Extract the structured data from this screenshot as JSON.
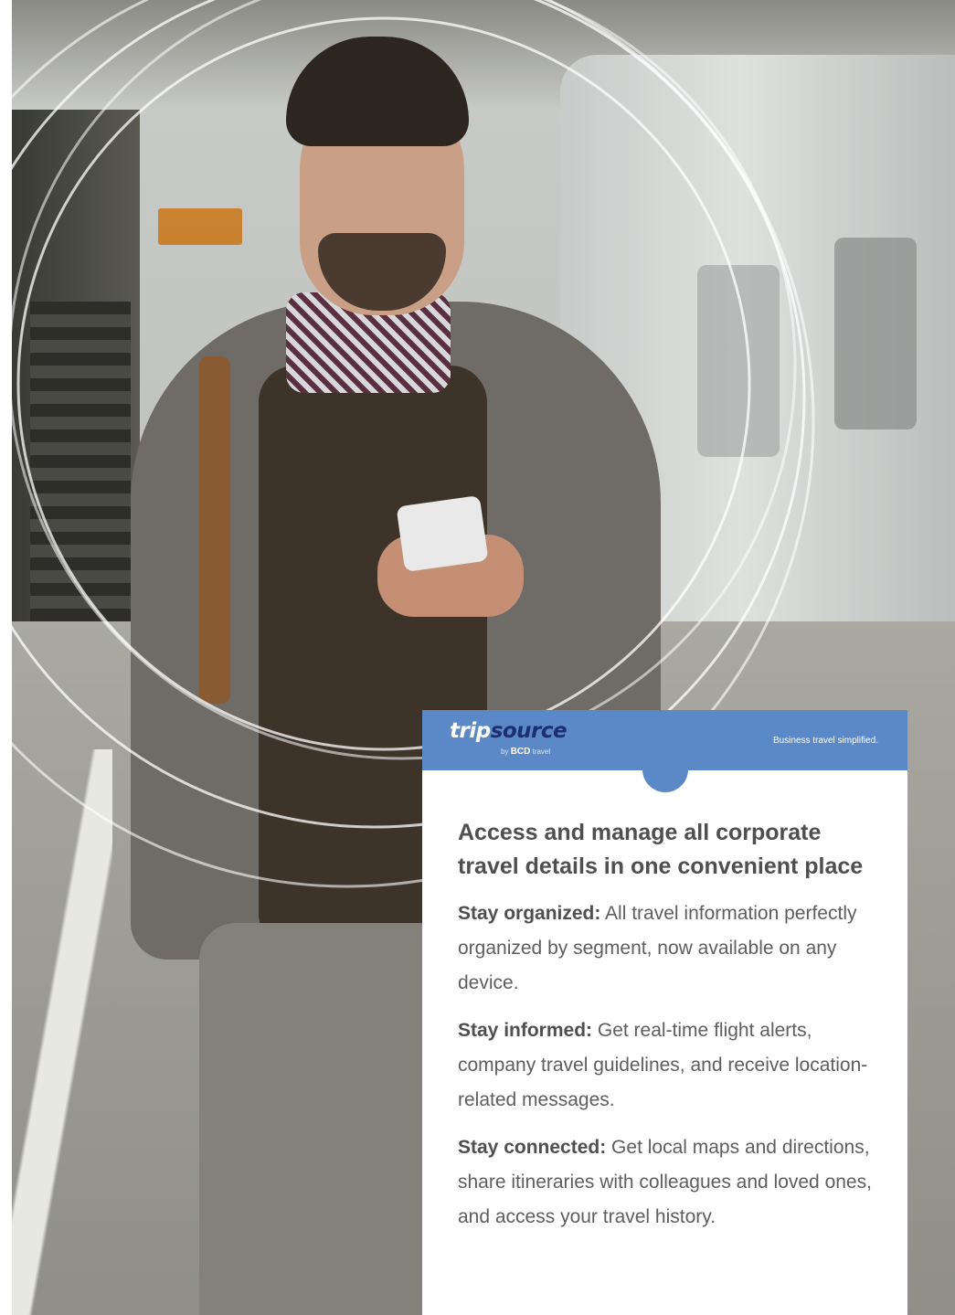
{
  "brand": {
    "logo_trip": "trip",
    "logo_source": "source",
    "logo_by": "by",
    "logo_bcd": "BCD",
    "logo_travel": "travel",
    "tagline": "Business travel simplified.",
    "header_color": "#5b89c7",
    "logo_dark_color": "#1c2f6e"
  },
  "card": {
    "headline": "Access and manage all corporate travel details in one convenient place",
    "features": [
      {
        "lead": "Stay organized:",
        "text": " All travel information perfectly organized by segment, now available on any device."
      },
      {
        "lead": "Stay informed:",
        "text": " Get real-time flight alerts, company travel guidelines, and receive location-related messages."
      },
      {
        "lead": "Stay connected:",
        "text": " Get local maps and directions, share itineraries with colleagues and loved ones, and access your travel history."
      }
    ]
  }
}
